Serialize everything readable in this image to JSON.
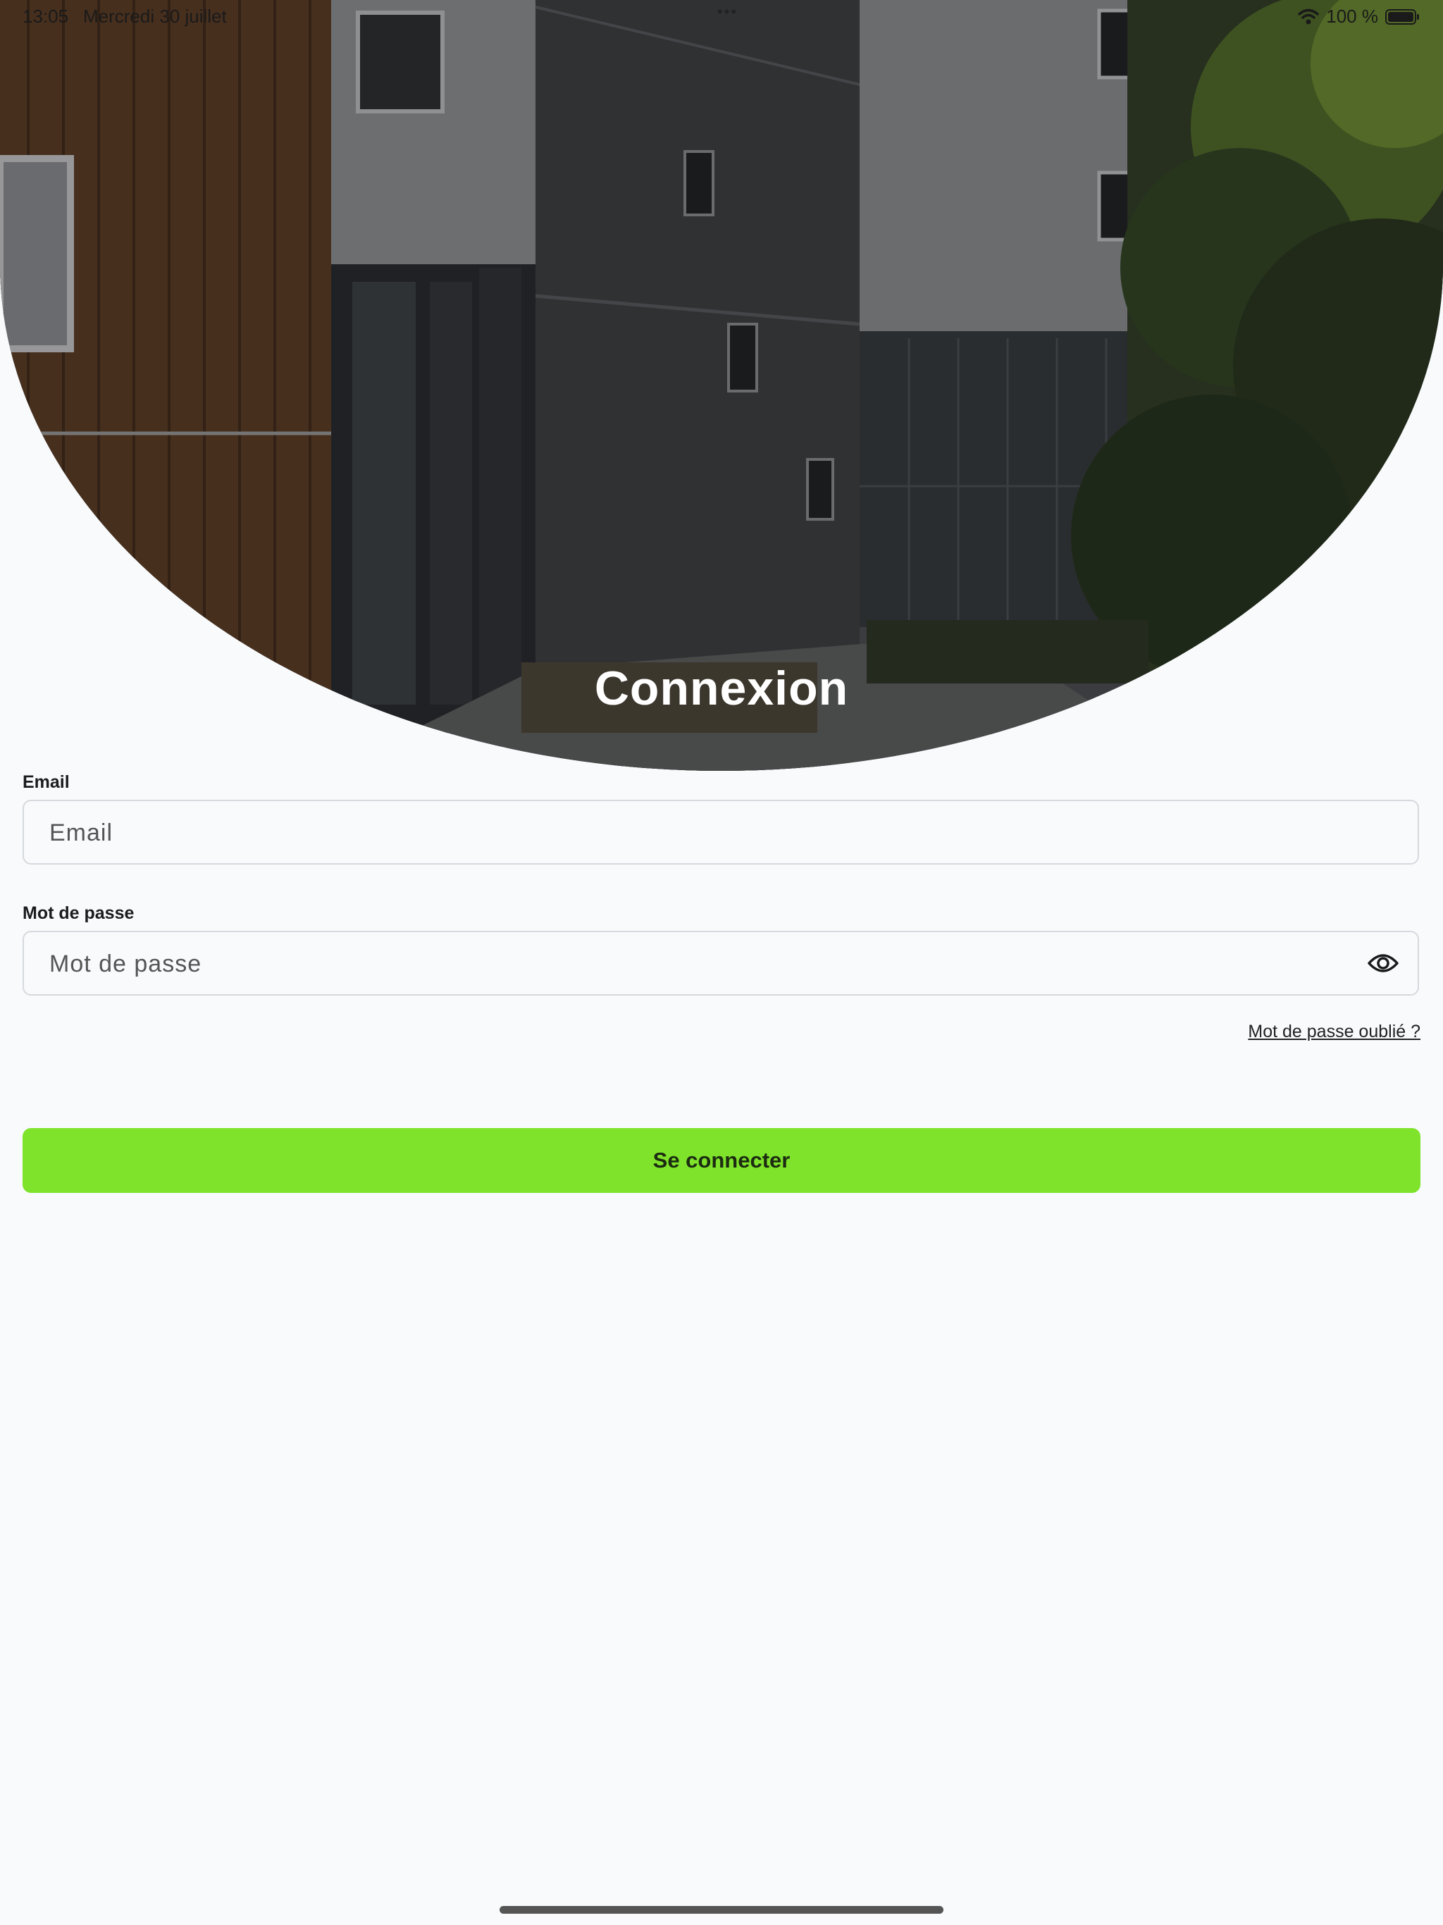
{
  "status_bar": {
    "time": "13:05",
    "date": "Mercredi 30 juillet",
    "battery": "100 %"
  },
  "hero": {
    "title": "Connexion"
  },
  "form": {
    "email_label": "Email",
    "email_placeholder": "Email",
    "email_value": "",
    "password_label": "Mot de passe",
    "password_placeholder": "Mot de passe",
    "password_value": "",
    "forgot_password": "Mot de passe oublié ?",
    "submit_label": "Se connecter"
  },
  "colors": {
    "accent": "#7ee32a",
    "background": "#f8fafc"
  },
  "icons": [
    "wifi-icon",
    "battery-icon",
    "eye-icon"
  ]
}
